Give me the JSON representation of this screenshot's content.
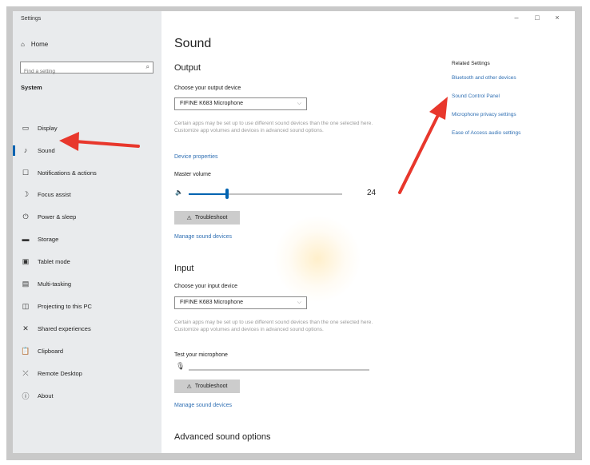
{
  "window": {
    "title": "Settings",
    "min": "–",
    "max": "□",
    "close": "×"
  },
  "sidebar": {
    "home": "Home",
    "search_placeholder": "Find a setting",
    "section": "System",
    "items": [
      {
        "label": "Display",
        "icon": "display-icon",
        "glyph": "▭"
      },
      {
        "label": "Sound",
        "icon": "speaker-icon",
        "glyph": "♪"
      },
      {
        "label": "Notifications & actions",
        "icon": "notifications-icon",
        "glyph": "☐"
      },
      {
        "label": "Focus assist",
        "icon": "moon-icon",
        "glyph": "☽"
      },
      {
        "label": "Power & sleep",
        "icon": "power-icon",
        "glyph": "⏻"
      },
      {
        "label": "Storage",
        "icon": "storage-icon",
        "glyph": "▬"
      },
      {
        "label": "Tablet mode",
        "icon": "tablet-icon",
        "glyph": "▣"
      },
      {
        "label": "Multi-tasking",
        "icon": "multitasking-icon",
        "glyph": "▤"
      },
      {
        "label": "Projecting to this PC",
        "icon": "projector-icon",
        "glyph": "◫"
      },
      {
        "label": "Shared experiences",
        "icon": "shared-icon",
        "glyph": "✕"
      },
      {
        "label": "Clipboard",
        "icon": "clipboard-icon",
        "glyph": "📋"
      },
      {
        "label": "Remote Desktop",
        "icon": "remote-desktop-icon",
        "glyph": "⤫"
      },
      {
        "label": "About",
        "icon": "info-icon",
        "glyph": "ⓘ"
      }
    ]
  },
  "main": {
    "title": "Sound",
    "output": {
      "heading": "Output",
      "choose_label": "Choose your output device",
      "device": "FIFINE K683 Microphone",
      "description": "Certain apps may be set up to use different sound devices than the one selected here. Customize app volumes and devices in advanced sound options.",
      "device_properties": "Device properties",
      "master_volume_label": "Master volume",
      "volume": 24,
      "troubleshoot": "Troubleshoot",
      "manage": "Manage sound devices"
    },
    "input": {
      "heading": "Input",
      "choose_label": "Choose your input device",
      "device": "FIFINE K683 Microphone",
      "description": "Certain apps may be set up to use different sound devices than the one selected here. Customize app volumes and devices in advanced sound options.",
      "test_label": "Test your microphone",
      "troubleshoot": "Troubleshoot",
      "manage": "Manage sound devices"
    },
    "advanced": "Advanced sound options"
  },
  "related": {
    "title": "Related Settings",
    "links": [
      "Bluetooth and other devices",
      "Sound Control Panel",
      "Microphone privacy settings",
      "Ease of Access audio settings"
    ]
  },
  "colors": {
    "accent": "#0063b1",
    "link": "#2f6fb3",
    "arrow": "#e8372c"
  }
}
